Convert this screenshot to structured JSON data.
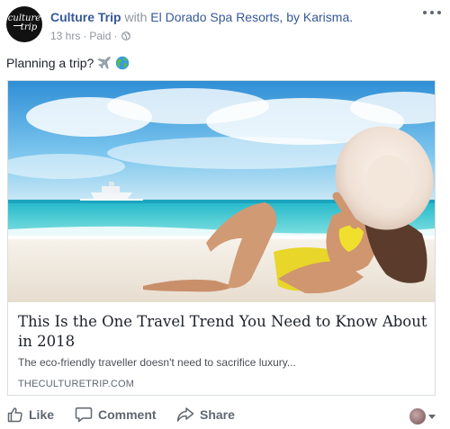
{
  "page": {
    "name": "Culture Trip",
    "with_text": " with ",
    "partner": "El Dorado Spa Resorts, by Karisma.",
    "avatar_line1": "culture",
    "avatar_line2": "trip",
    "time": "13 hrs",
    "separator": "·",
    "paid": "Paid",
    "audience_icon": "globe-icon"
  },
  "post": {
    "text": "Planning a trip?",
    "emojis": [
      "airplane",
      "globe-earth"
    ]
  },
  "link": {
    "image_desc": "beach-photo",
    "title": "This Is the One Travel Trend You Need to Know About in 2018",
    "description": "The eco-friendly traveller doesn't need to sacrifice luxury...",
    "domain": "THECULTURETRIP.COM"
  },
  "actions": {
    "like": "Like",
    "comment": "Comment",
    "share": "Share"
  },
  "colors": {
    "link_blue": "#365899",
    "meta_gray": "#90949c",
    "action_gray": "#606770",
    "sky": "#5fb6e8",
    "sea": "#2fc6d0",
    "sand": "#f1ebe1"
  }
}
